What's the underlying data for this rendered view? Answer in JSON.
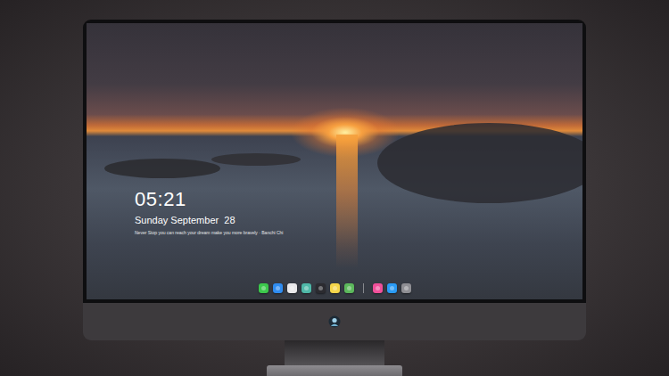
{
  "lock_screen": {
    "time": "05:21",
    "date": "Sunday September  28",
    "quote": "Never Stop you can reach your dream make you more bravely · Banchi Chi"
  },
  "dock": {
    "items": [
      {
        "kind": "app",
        "color": "#3cc84c"
      },
      {
        "kind": "app",
        "color": "#2f8cf0"
      },
      {
        "kind": "app",
        "color": "#e8e8ea"
      },
      {
        "kind": "app",
        "color": "#4fb8a8"
      },
      {
        "kind": "app",
        "color": "#2b2b30"
      },
      {
        "kind": "app",
        "color": "#f5d54a"
      },
      {
        "kind": "app",
        "color": "#5cb85c"
      },
      {
        "kind": "separator"
      },
      {
        "kind": "app",
        "color": "#f0509a"
      },
      {
        "kind": "app",
        "color": "#2a9bf5"
      },
      {
        "kind": "app",
        "color": "#8e8e93"
      }
    ]
  }
}
